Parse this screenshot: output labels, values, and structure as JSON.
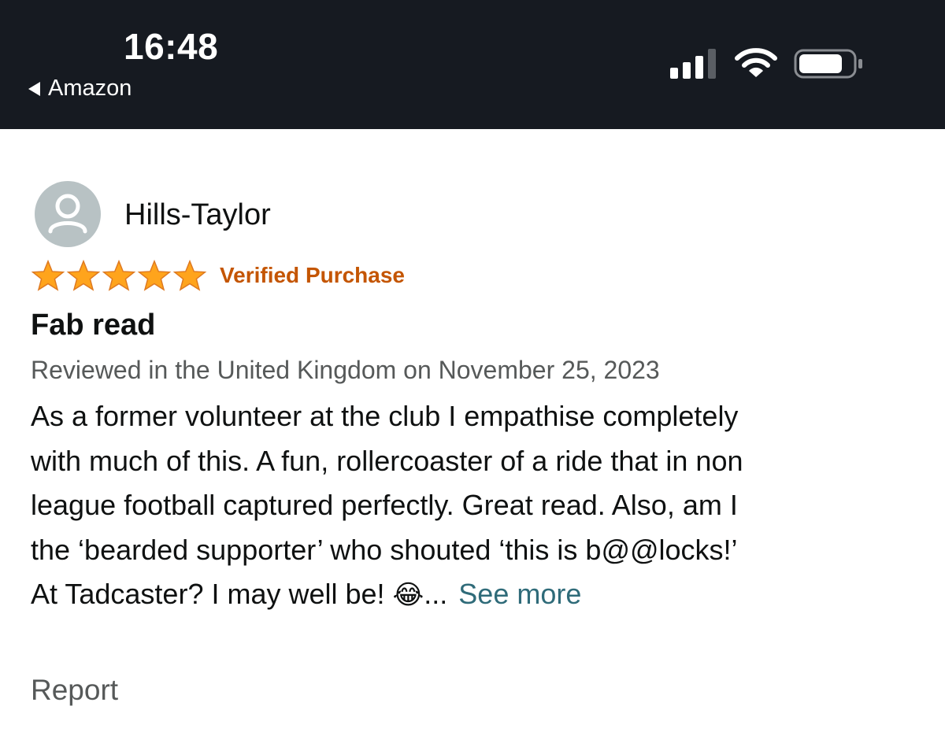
{
  "status_bar": {
    "time": "16:48",
    "back_label": "Amazon",
    "icons": [
      "cellular-signal-icon",
      "wifi-icon",
      "battery-icon"
    ]
  },
  "review": {
    "reviewer_name": "Hills-Taylor",
    "rating": 5,
    "rating_max": 5,
    "verified_label": "Verified Purchase",
    "title": "Fab read",
    "meta": "Reviewed in the United Kingdom on November 25, 2023",
    "body_lines": [
      "As a former volunteer at the club I empathise completely",
      "with much of this. A fun, rollercoaster of a ride that in non",
      "league football captured perfectly. Great read. Also, am I",
      "the ‘bearded supporter’ who shouted ‘this is b@@locks!’",
      "At Tadcaster? I may well be! "
    ],
    "emoji": "😂",
    "ellipsis": "...",
    "see_more_label": "See more",
    "report_label": "Report"
  },
  "colors": {
    "status_bar_bg": "#161a21",
    "star": "#ffa41c",
    "verified": "#c45500",
    "link": "#2f6b79",
    "secondary_text": "#565959"
  }
}
